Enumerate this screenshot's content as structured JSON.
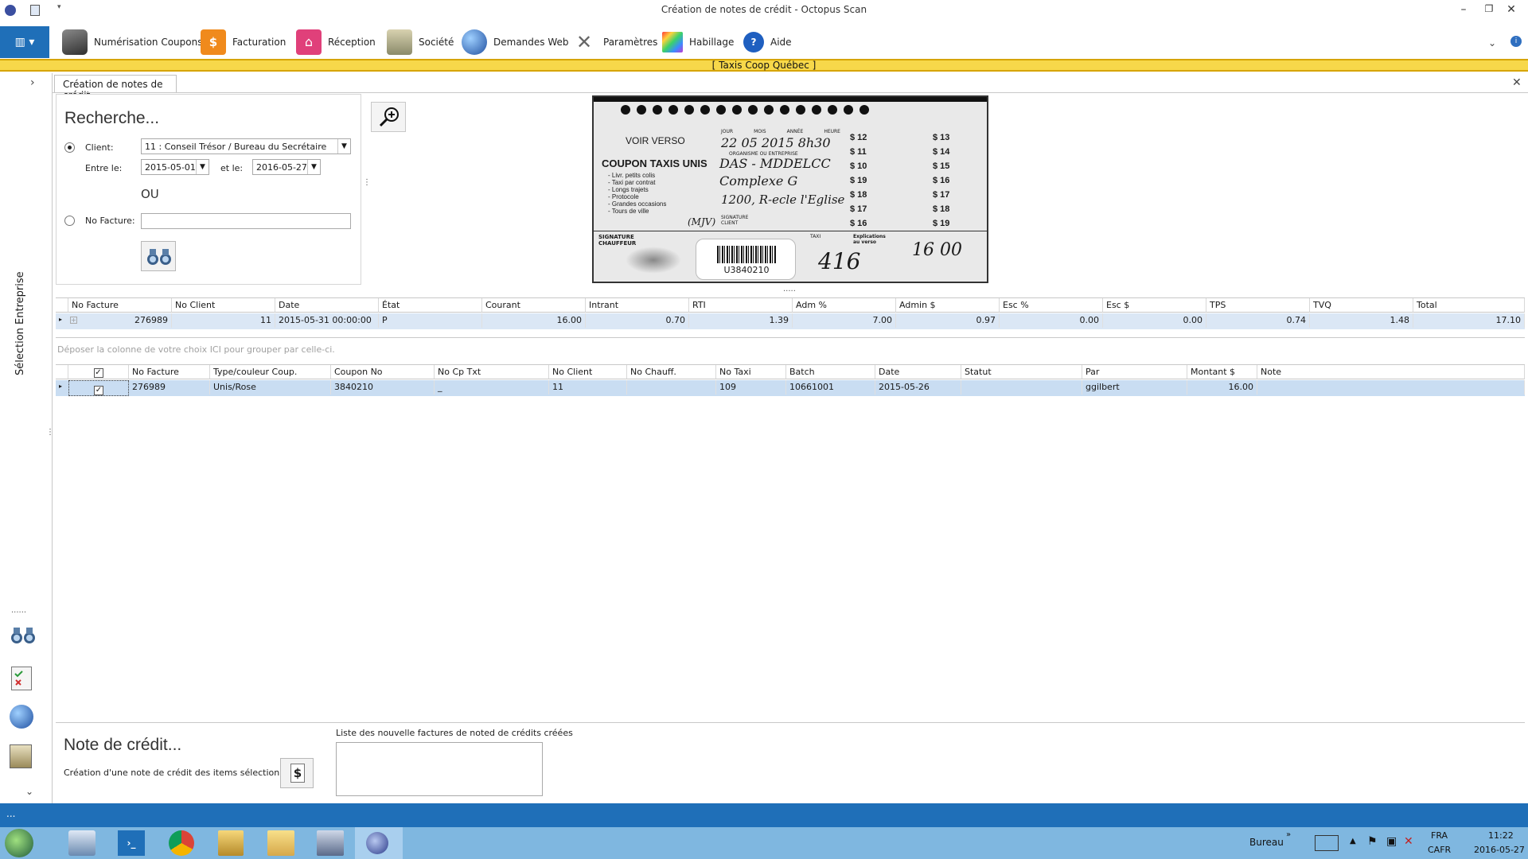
{
  "window": {
    "title": "Création de notes de crédit - Octopus Scan",
    "minimize": "–",
    "restore": "❐",
    "close": "✕"
  },
  "ribbon": {
    "items": [
      {
        "label": "Numérisation Coupons",
        "icon": "scanner-icon",
        "color": "#555555"
      },
      {
        "label": "Facturation",
        "icon": "invoice-dollar-icon",
        "color": "#f08a1c"
      },
      {
        "label": "Réception",
        "icon": "home-icon",
        "color": "#e0407a"
      },
      {
        "label": "Société",
        "icon": "building-list-icon",
        "color": "#8a8a6a"
      },
      {
        "label": "Demandes Web",
        "icon": "globe-icon",
        "color": "#2b5fb0"
      },
      {
        "label": "Paramètres",
        "icon": "tools-icon",
        "color": "#777777"
      },
      {
        "label": "Habillage",
        "icon": "palette-icon",
        "color": "#c03a6a"
      },
      {
        "label": "Aide",
        "icon": "help-icon",
        "color": "#1f5fc0"
      }
    ]
  },
  "company": {
    "name": "[   Taxis Coop Québec   ]"
  },
  "sidebar": {
    "label": "Sélection Entreprise",
    "dots": "......"
  },
  "tab": {
    "label": "Création de notes de crédit",
    "close": "✕"
  },
  "search": {
    "title": "Recherche...",
    "client_label": "Client:",
    "client_value": "11 : Conseil Trésor / Bureau du Secrétaire",
    "between_label": "Entre le:",
    "date_from": "2015-05-01",
    "and_label": "et le:",
    "date_to": "2016-05-27",
    "or_label": "OU",
    "invoice_label": "No Facture:",
    "invoice_value": ""
  },
  "coupon": {
    "verso": "VOIR VERSO",
    "heading": "COUPON TAXIS UNIS",
    "list": [
      "- Livr. petits colis",
      "- Taxi par contrat",
      "- Longs trajets",
      "- Protocole",
      "- Grandes occasions",
      "- Tours de ville"
    ],
    "date_hand": "22 05 2015 8h30",
    "org_hand": "DAS - MDDELCC",
    "from_hand": "Complexe G",
    "to_hand": "1200, R-ecle l'Eglise",
    "sig_client": "(MJV)",
    "taxi_hand": "416",
    "amount_hand": "16 00",
    "barcode": "U3840210",
    "amounts_left": [
      "$ 12",
      "$ 11",
      "$ 10",
      "$ 19",
      "$ 18",
      "$ 17",
      "$ 16"
    ],
    "amounts_right": [
      "$ 13",
      "$ 14",
      "$ 15",
      "$ 16",
      "$ 17",
      "$ 18",
      "$ 19"
    ],
    "sig_chauffeur": "SIGNATURE CHAUFFEUR",
    "explications": "Explications au verso",
    "header_small": [
      "JOUR",
      "MOIS",
      "ANNÉE",
      "HEURE"
    ],
    "org_small": "ORGANISME OU ENTREPRISE",
    "sig_small": "SIGNATURE CLIENT",
    "taxi_small": "TAXI"
  },
  "invoices_grid": {
    "columns": [
      "No Facture",
      "No Client",
      "Date",
      "État",
      "Courant",
      "Intrant",
      "RTI",
      "Adm %",
      "Admin $",
      "Esc %",
      "Esc $",
      "TPS",
      "TVQ",
      "Total"
    ],
    "rows": [
      [
        "276989",
        "11",
        "2015-05-31 00:00:00",
        "P",
        "16.00",
        "0.70",
        "1.39",
        "7.00",
        "0.97",
        "0.00",
        "0.00",
        "0.74",
        "1.48",
        "17.10"
      ]
    ]
  },
  "group_hint": "Déposer la colonne de votre choix ICI pour grouper par celle-ci.",
  "coupons_grid": {
    "columns": [
      "No Facture",
      "Type/couleur Coup.",
      "Coupon No",
      "No Cp Txt",
      "No Client",
      "No Chauff.",
      "No Taxi",
      "Batch",
      "Date",
      "Statut",
      "Par",
      "Montant $",
      "Note"
    ],
    "rows": [
      [
        "276989",
        "Unis/Rose",
        "3840210",
        "_",
        "11",
        "",
        "109",
        "10661001",
        "2015-05-26",
        "",
        "ggilbert",
        "16.00",
        ""
      ]
    ]
  },
  "credit": {
    "title": "Note de crédit...",
    "create_label": "Création d'une note de crédit des items sélectionnés:",
    "list_label": "Liste des nouvelle factures de noted de crédits créées"
  },
  "statusbar": {
    "text": "..."
  },
  "taskbar": {
    "desktop": "Bureau",
    "lang1": "FRA",
    "lang2": "CAFR",
    "time": "11:22",
    "date": "2016-05-27"
  }
}
